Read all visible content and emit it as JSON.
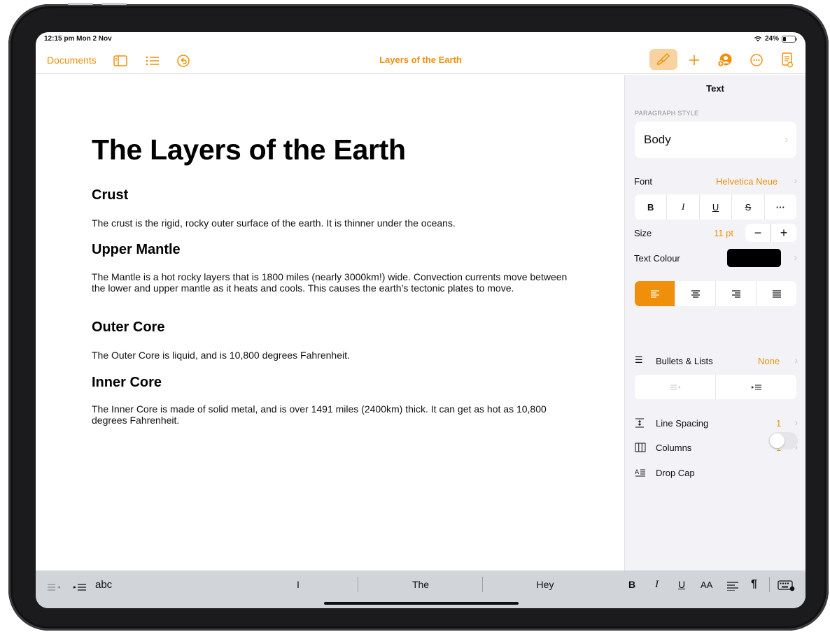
{
  "status": {
    "time": "12:15 pm  Mon 2 Nov",
    "battery": "24%",
    "battery_level": 0.24
  },
  "toolbar": {
    "documents_label": "Documents",
    "title": "Layers of the Earth",
    "icons": [
      "sidebar-icon",
      "list-icon",
      "undo-icon",
      "paintbrush-icon",
      "plus-icon",
      "collaborate-icon",
      "more-icon",
      "document-icon"
    ],
    "accent": "#f0900a"
  },
  "document": {
    "title": "The Layers of the Earth",
    "sections": [
      {
        "heading": "Crust",
        "body": "The crust is the rigid, rocky outer surface of the earth. It is thinner under the oceans."
      },
      {
        "heading": "Upper Mantle",
        "body": "The Mantle is a hot rocky layers that is 1800 miles (nearly 3000km!) wide. Convection currents move between the lower and upper mantle as it heats and cools. This causes the earth’s tectonic plates to move."
      },
      {
        "heading": "Outer Core",
        "body": "The Outer Core is liquid, and is 10,800 degrees Fahrenheit."
      },
      {
        "heading": "Inner Core",
        "body": "The Inner Core is made of solid metal, and is over 1491 miles (2400km) thick. It can get as hot as 10,800 degrees Fahrenheit."
      }
    ]
  },
  "panel": {
    "title": "Text",
    "paragraph_style_label": "PARAGRAPH STYLE",
    "paragraph_style": "Body",
    "font_label": "Font",
    "font_value": "Helvetica Neue",
    "style_buttons": [
      "B",
      "I",
      "U",
      "S",
      "···"
    ],
    "size_label": "Size",
    "size_value": "11 pt",
    "text_colour_label": "Text Colour",
    "text_colour": "#000000",
    "alignment_selected": "left",
    "bullets_label": "Bullets & Lists",
    "bullets_value": "None",
    "line_spacing_label": "Line Spacing",
    "line_spacing_value": "1",
    "columns_label": "Columns",
    "columns_value": "1",
    "drop_cap_label": "Drop Cap",
    "drop_cap_on": false
  },
  "shortcut_bar": {
    "abc_label": "abc",
    "suggestions": [
      "I",
      "The",
      "Hey"
    ],
    "format_buttons": [
      "B",
      "I",
      "U",
      "AA",
      "¶"
    ]
  }
}
